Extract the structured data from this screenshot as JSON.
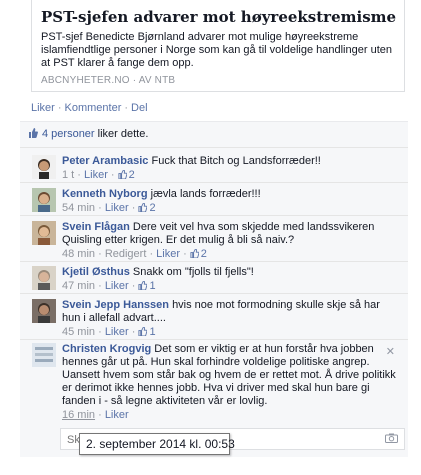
{
  "link_card": {
    "title": "PST-sjefen advarer mot høyreekstremisme",
    "description": "PST-sjef Benedicte Bjørnland advarer mot mulige høyreekstreme islamfiendtlige personer i Norge som kan gå til voldelige handlinger uten at PST klarer å fange dem opp.",
    "source": "ABCNYHETER.NO",
    "via": "AV NTB"
  },
  "actions": {
    "like": "Liker",
    "comment": "Kommenter",
    "share": "Del"
  },
  "likes_summary": {
    "people": "4 personer",
    "suffix": " liker dette."
  },
  "comments": [
    {
      "author": "Peter Arambasic",
      "text": "Fuck that Bitch og Landsforræder!!",
      "time": "1 t",
      "edited": "",
      "like": "Liker",
      "likes": "2"
    },
    {
      "author": "Kenneth Nyborg",
      "text": "jævla lands forræder!!!",
      "time": "54 min",
      "edited": "",
      "like": "Liker",
      "likes": "2"
    },
    {
      "author": "Svein Flågan",
      "text": "Dere veit vel hva som skjedde med landssvikeren Quisling etter krigen. Er det mulig å bli så naiv.?",
      "time": "48 min",
      "edited": "Redigert",
      "like": "Liker",
      "likes": "2"
    },
    {
      "author": "Kjetil Østhus",
      "text": "Snakk om \"fjolls til fjells\"!",
      "time": "47 min",
      "edited": "",
      "like": "Liker",
      "likes": "1"
    },
    {
      "author": "Svein Jepp Hanssen",
      "text": "hvis noe mot formodning skulle skje så har hun i allefall advart....",
      "time": "45 min",
      "edited": "",
      "like": "Liker",
      "likes": "1"
    },
    {
      "author": "Christen Krogvig",
      "text": "Det som er viktig er at hun forstår hva jobben hennes går ut på. Hun skal forhindre voldelige politiske angrep. Uansett hvem som står bak og hvem de er rettet mot. Å drive politikk er derimot ikke hennes jobb. Hva vi driver med skal hun bare gi fanden i - så legne aktiviteten vår er lovlig.",
      "time": "16 min",
      "edited": "",
      "like": "Liker",
      "likes": ""
    }
  ],
  "reply": {
    "placeholder": "Skriv en kommentar..."
  },
  "tooltip": "2. september 2014 kl. 00:53",
  "colors": {
    "link": "#3b5998",
    "meta": "#90949c",
    "feedback_bg": "#f6f7f9"
  }
}
